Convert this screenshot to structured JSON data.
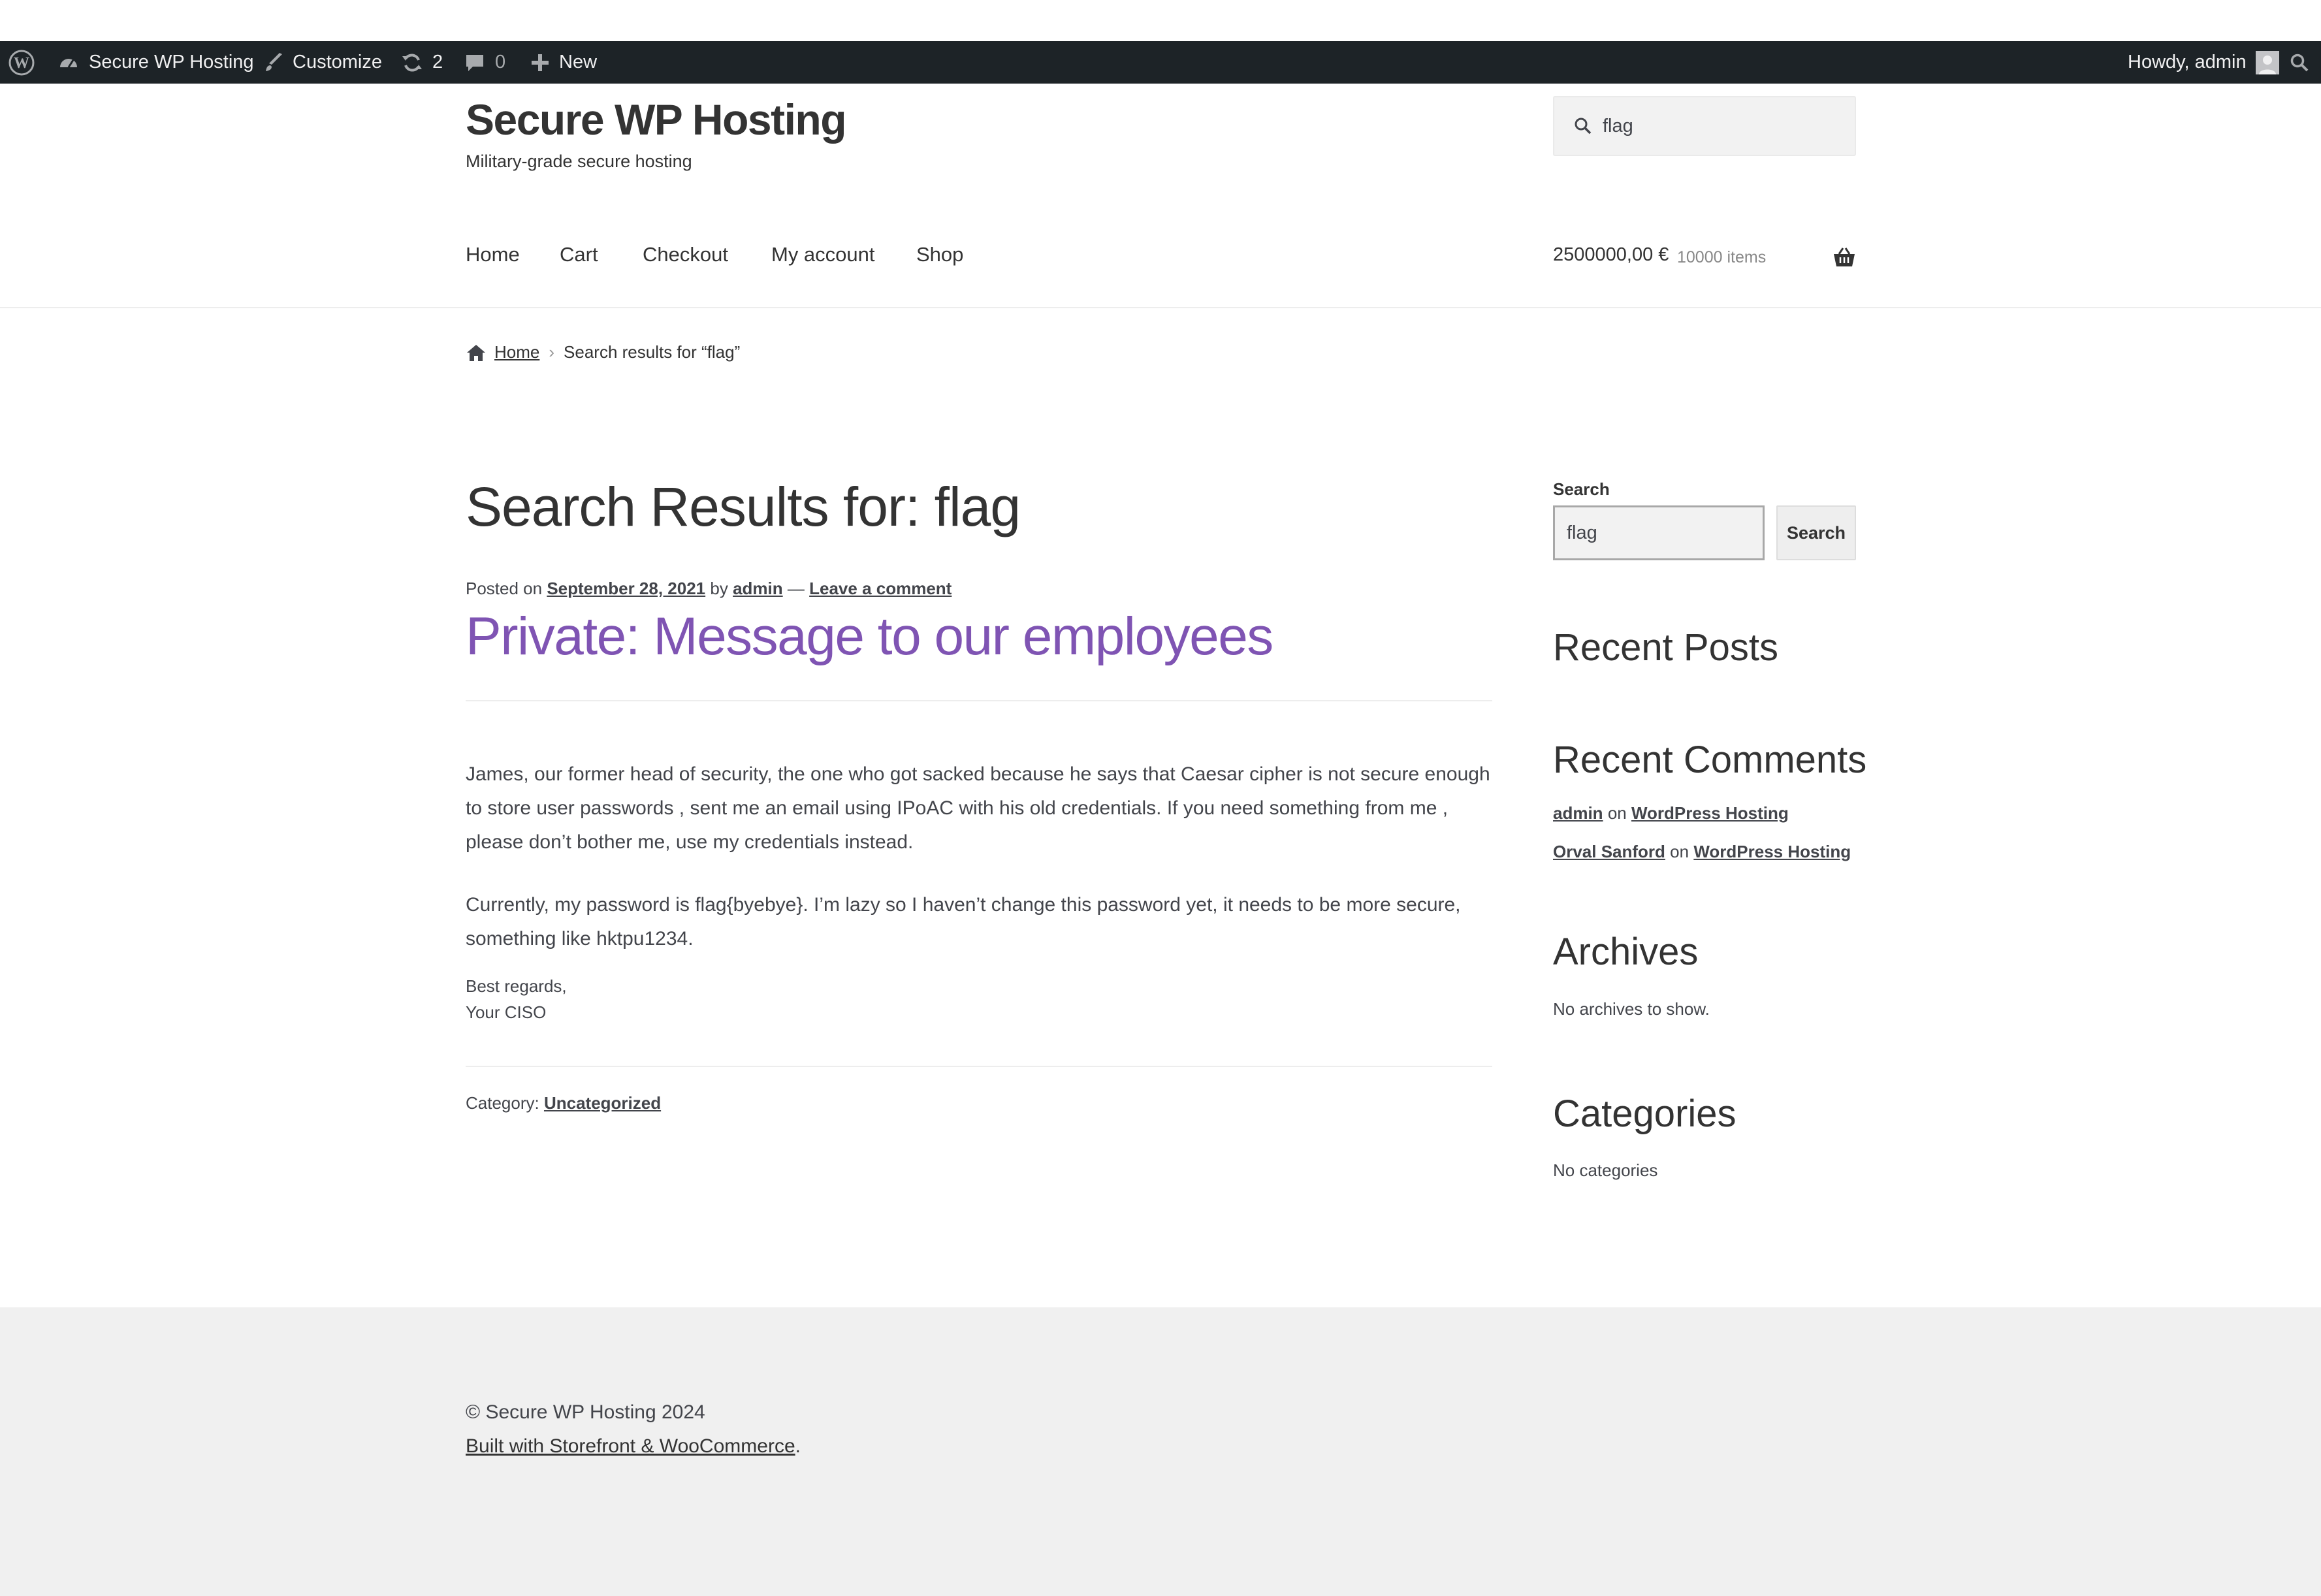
{
  "admin_bar": {
    "site_name": "Secure WP Hosting",
    "customize": "Customize",
    "updates_count": "2",
    "comments_count": "0",
    "new_label": "New",
    "howdy": "Howdy, admin"
  },
  "header": {
    "site_title": "Secure WP Hosting",
    "site_description": "Military-grade secure hosting",
    "search_value": "flag",
    "nav": [
      "Home",
      "Cart",
      "Checkout",
      "My account",
      "Shop"
    ],
    "cart_total": "2500000,00 €",
    "cart_count": "10000 items"
  },
  "breadcrumb": {
    "home": "Home",
    "current": "Search results for “flag”"
  },
  "main": {
    "page_title": "Search Results for: flag",
    "posted_on": "Posted on",
    "date": "September 28, 2021",
    "by": "by",
    "author": "admin",
    "dash": "—",
    "leave_comment": "Leave a comment",
    "post_title": "Private: Message to our employees",
    "paragraph_1": "James, our former head of security, the one who got sacked because he says that Caesar cipher is not secure enough to store user passwords , sent me an email using IPoAC with his old credentials. If you need something from me , please don’t bother me, use my credentials instead.",
    "paragraph_2": "Currently, my password is flag{byebye}. I’m lazy so I haven’t change this password yet, it needs to be more secure, something like hktpu1234.",
    "signature_1": "Best regards,",
    "signature_2": "Your CISO",
    "category_label": "Category:",
    "category": "Uncategorized"
  },
  "sidebar": {
    "search_label": "Search",
    "search_value": "flag",
    "search_button": "Search",
    "recent_posts": "Recent Posts",
    "recent_comments": "Recent Comments",
    "comments": [
      {
        "author": "admin",
        "on": "on",
        "post": "WordPress Hosting"
      },
      {
        "author": "Orval Sanford",
        "on": "on",
        "post": "WordPress Hosting"
      }
    ],
    "archives": "Archives",
    "no_archives": "No archives to show.",
    "categories": "Categories",
    "no_categories": "No categories"
  },
  "footer": {
    "copyright": "© Secure WP Hosting 2024",
    "credit_link": "Built with Storefront & WooCommerce",
    "credit_period": "."
  },
  "colors": {
    "admin_bar": "#1d2327",
    "accent_link": "#7f54b3",
    "footer_bg": "#f0f0f0",
    "text": "#43454b"
  },
  "icons": [
    "wordpress-icon",
    "dashboard-icon",
    "brush-icon",
    "updates-icon",
    "comment-icon",
    "plus-icon",
    "avatar-icon",
    "search-icon",
    "basket-icon",
    "home-icon",
    "chevron-right-icon"
  ]
}
